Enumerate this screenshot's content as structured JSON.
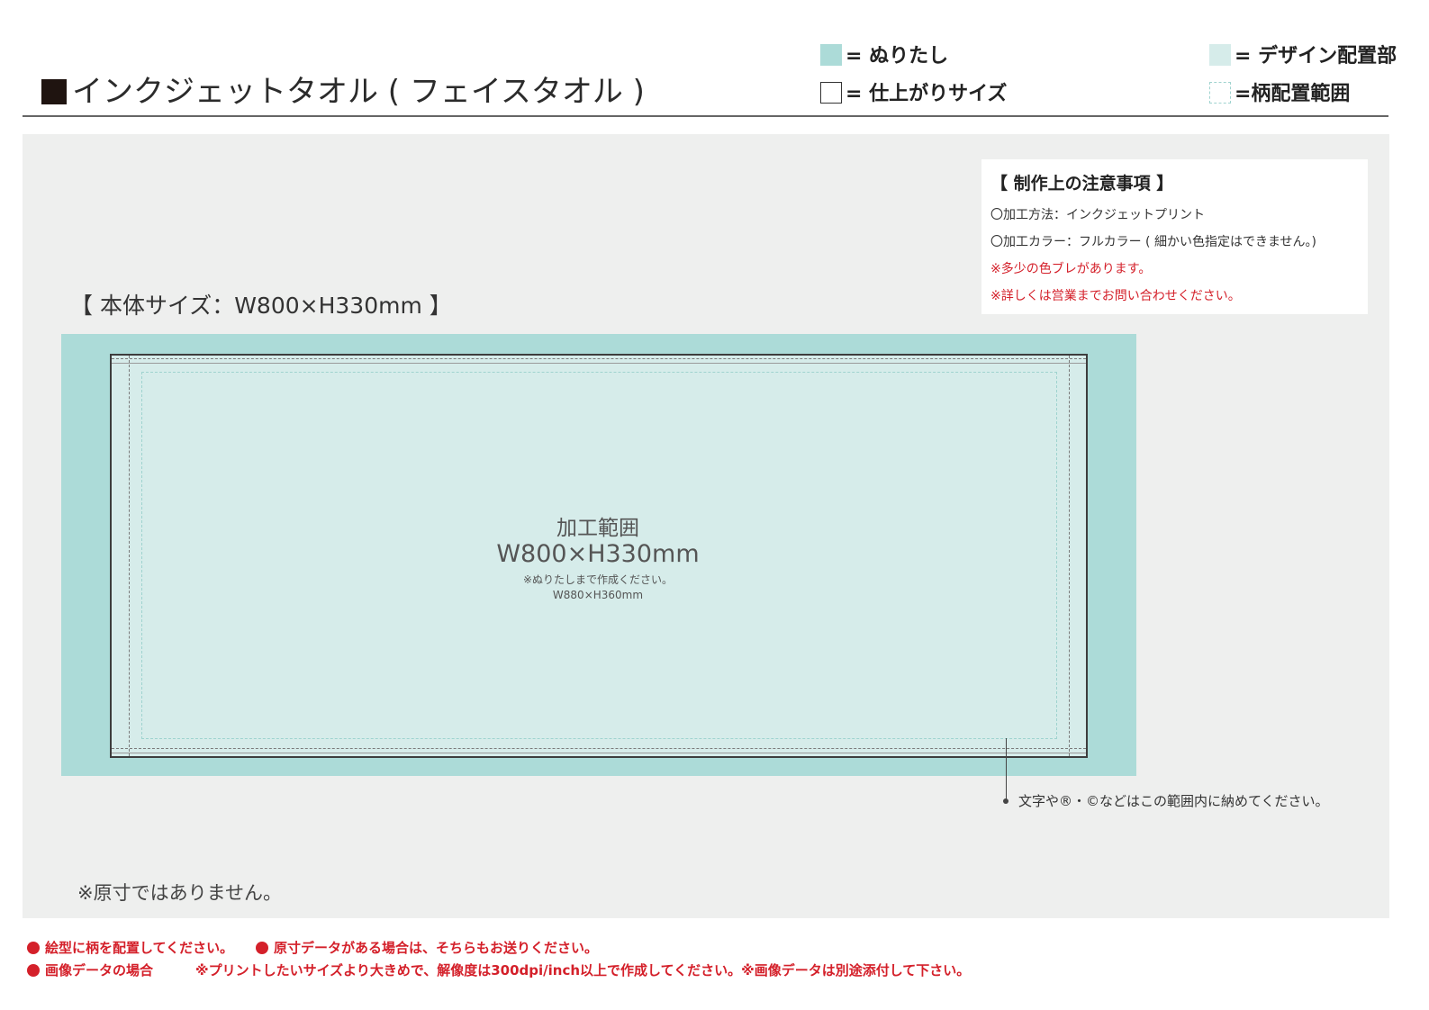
{
  "header": {
    "title": "インクジェットタオル ( フェイスタオル )"
  },
  "legend": {
    "bleed": "= ぬりたし",
    "finish": "= 仕上がりサイズ",
    "design": "= デザイン配置部",
    "pattern": "=柄配置範囲",
    "colors": {
      "bleed": "#acdbd8",
      "design": "#d6ecea",
      "pattern_border": "#9fd3cf"
    }
  },
  "notes": {
    "heading": "【 制作上の注意事項 】",
    "method": "〇加工方法：インクジェットプリント",
    "color": "〇加工カラー：フルカラー ( 細かい色指定はできません。)",
    "warn1": "※多少の色ブレがあります。",
    "warn2": "※詳しくは営業までお問い合わせください。"
  },
  "diagram": {
    "body_size": "【 本体サイズ：W800×H330mm 】",
    "area_label": "加工範囲",
    "area_size": "W800×H330mm",
    "bleed_note": "※ぬりたしまで作成ください。",
    "bleed_size": "W880×H360mm",
    "callout": "文字や®・©などはこの範囲内に納めてください。",
    "not_actual": "※原寸ではありません。"
  },
  "footer": {
    "line1a": "絵型に柄を配置してください。",
    "line1b": "原寸データがある場合は、そちらもお送りください。",
    "line2a": "画像データの場合",
    "line2b": "※プリントしたいサイズより大きめで、解像度は300dpi/inch以上で作成してください。※画像データは別途添付して下さい。",
    "accent": "#d4202a"
  }
}
